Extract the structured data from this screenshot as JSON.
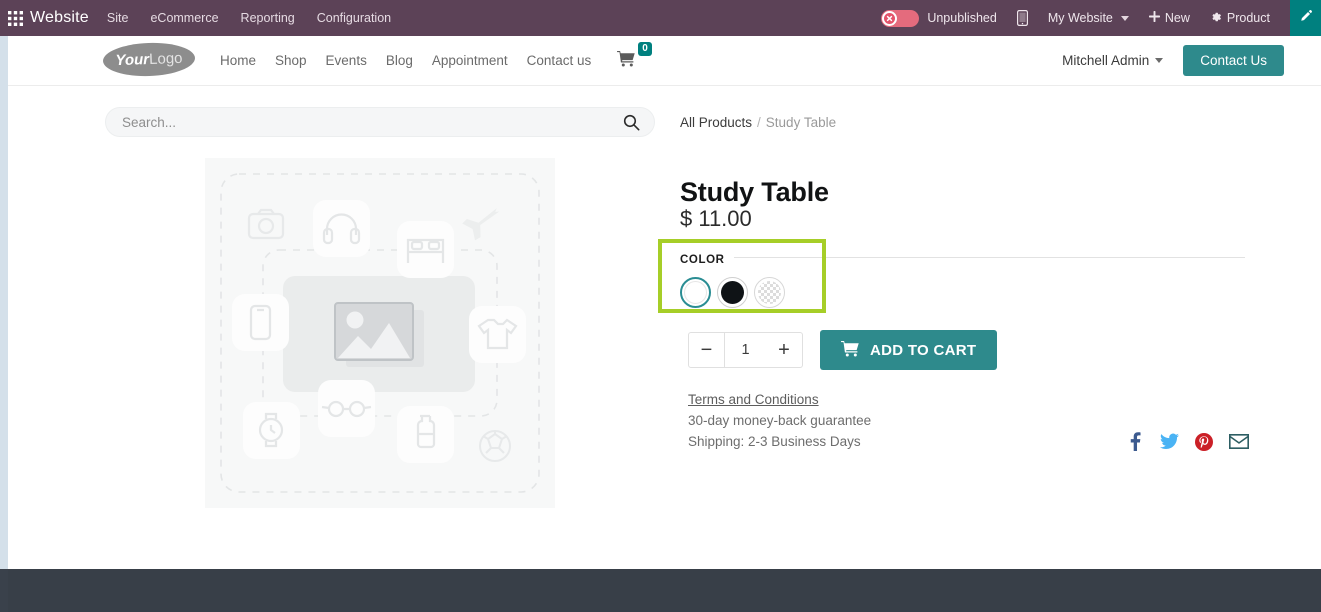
{
  "backend_topbar": {
    "apps_icon": "apps-grid-icon",
    "brand": "Website",
    "menus": [
      "Site",
      "eCommerce",
      "Reporting",
      "Configuration"
    ],
    "publish_state": "Unpublished",
    "publish_toggle_icon": "x-circle-icon",
    "mobile_preview_icon": "mobile-icon",
    "website_selector": "My Website",
    "new_label": "New",
    "new_icon": "plus-icon",
    "product_label": "Product",
    "product_icon": "gear-icon",
    "edit_icon": "pencil-icon",
    "colors": {
      "bar": "#5c4257",
      "accent_teal": "#00807f",
      "toggle_off": "#e46b7d"
    }
  },
  "site_header": {
    "logo": {
      "prefix": "Your",
      "suffix": "Logo"
    },
    "nav": [
      "Home",
      "Shop",
      "Events",
      "Blog",
      "Appointment",
      "Contact us"
    ],
    "cart_icon": "shopping-cart-icon",
    "cart_count": "0",
    "user": "Mitchell Admin",
    "cta_label": "Contact Us",
    "colors": {
      "cta": "#2e8a8c",
      "badge": "#00807f"
    }
  },
  "search": {
    "placeholder": "Search...",
    "value": "",
    "icon": "search-icon"
  },
  "product": {
    "image_alt": "product-image-placeholder",
    "breadcrumb": {
      "root": "All Products",
      "separator": "/",
      "current": "Study Table"
    },
    "title": "Study Table",
    "price": "$ 11.00",
    "attribute": {
      "label": "COLOR",
      "highlighted": true,
      "highlight_color": "#a6ce28",
      "options": [
        {
          "name": "white",
          "swatch": "white",
          "selected": true
        },
        {
          "name": "black",
          "swatch": "black",
          "selected": false
        },
        {
          "name": "no-color",
          "swatch": "checkered",
          "selected": false
        }
      ]
    },
    "quantity": {
      "decrease_label": "−",
      "value": "1",
      "increase_label": "+"
    },
    "add_to_cart": {
      "label": "ADD TO CART",
      "icon": "cart-icon"
    },
    "terms_link": "Terms and Conditions",
    "guarantee": "30-day money-back guarantee",
    "shipping": "Shipping: 2-3 Business Days",
    "share": [
      {
        "name": "facebook-icon",
        "color": "#3b5998"
      },
      {
        "name": "twitter-icon",
        "color": "#4ab3f4"
      },
      {
        "name": "pinterest-icon",
        "color": "#cb2027"
      },
      {
        "name": "email-icon",
        "color": "#2d5e63"
      }
    ]
  },
  "footer": {
    "background": "#383f48"
  }
}
